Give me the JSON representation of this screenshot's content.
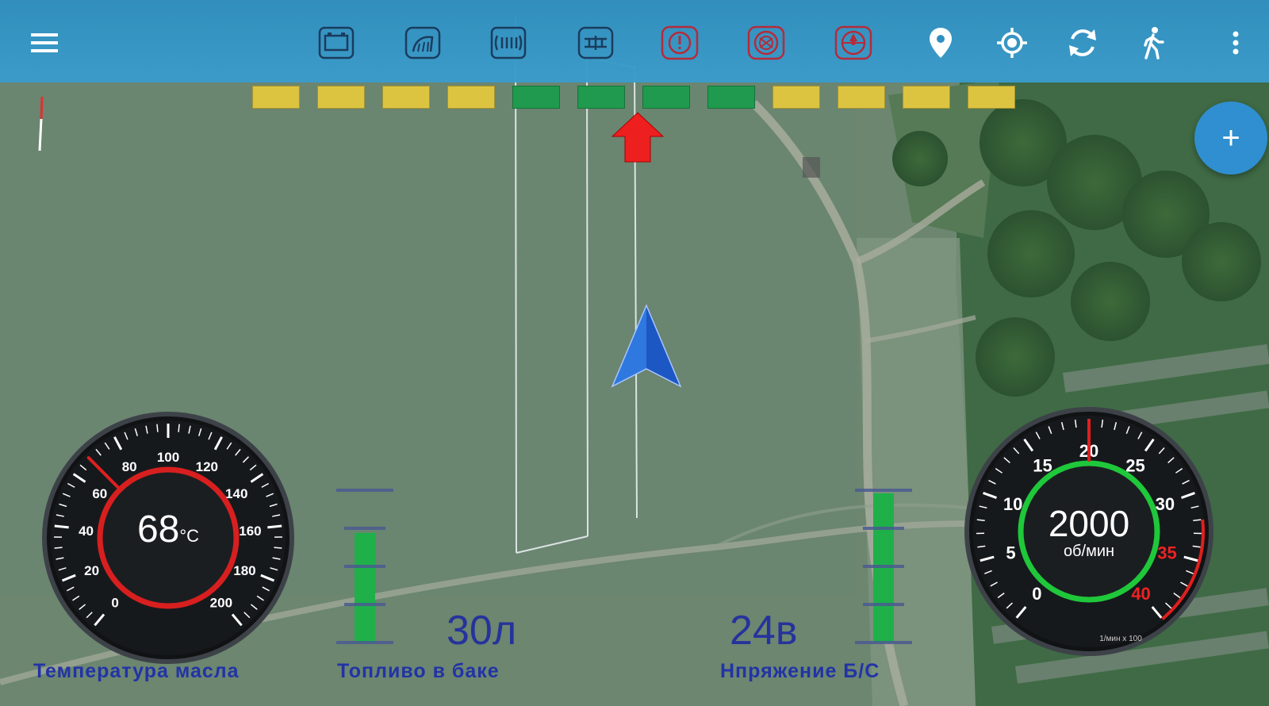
{
  "toolbar": {
    "menu_icon": "hamburger-menu-icon",
    "warning_icons": [
      "battery-warning-icon",
      "engine-cooling-warning-icon",
      "glow-plug-warning-icon",
      "transmission-warning-icon",
      "oil-pressure-warning-icon",
      "brake-warning-icon",
      "parking-brake-warning-icon"
    ],
    "action_icons": [
      "location-pin-icon",
      "gps-target-icon",
      "sync-icon",
      "walk-icon",
      "more-vert-icon"
    ]
  },
  "section_indicator": {
    "colors": [
      "yellow",
      "yellow",
      "yellow",
      "yellow",
      "green",
      "green",
      "green",
      "green",
      "yellow",
      "yellow",
      "yellow",
      "yellow"
    ],
    "palette": {
      "yellow": "#dcc441",
      "green": "#1f9a4e"
    }
  },
  "fab": {
    "label": "+"
  },
  "oil_temp": {
    "value": "68",
    "unit": "°C",
    "ticks": [
      "0",
      "20",
      "40",
      "60",
      "80",
      "100",
      "120",
      "140",
      "160",
      "180",
      "200"
    ],
    "label": "Температура масла",
    "value_numeric": 68,
    "range": [
      0,
      200
    ]
  },
  "fuel": {
    "value": "30л",
    "label": "Топливо в баке",
    "level_fraction": 0.72
  },
  "voltage": {
    "value": "24в",
    "label": "Нпряжение Б/С",
    "level_fraction": 0.98
  },
  "rpm": {
    "value": "2000",
    "unit": "об/мин",
    "ticks": [
      "0",
      "5",
      "10",
      "15",
      "20",
      "25",
      "30",
      "35",
      "40"
    ],
    "redline_ticks": [
      "35",
      "40"
    ],
    "multiplier": "1/мин x 100",
    "value_numeric": 20,
    "range": [
      0,
      40
    ]
  },
  "colors": {
    "accent": "#2f8fd0",
    "alert": "#e01f1f",
    "ok": "#1fb04a",
    "label": "#2233a6"
  }
}
